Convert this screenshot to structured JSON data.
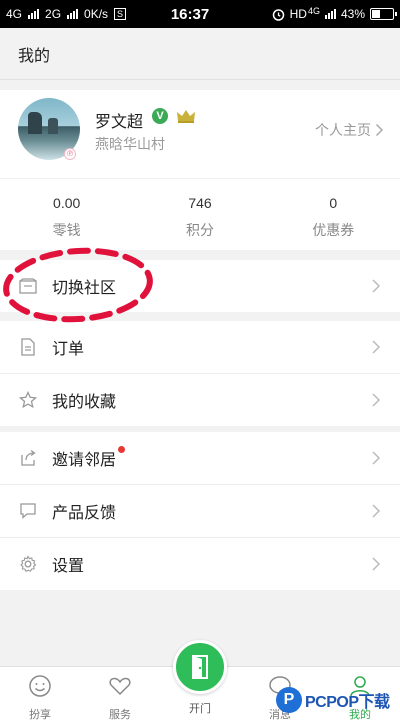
{
  "status_bar": {
    "sim1": "4G",
    "sim2": "2G",
    "speed": "0K/s",
    "sim_icon": "S",
    "time": "16:37",
    "network": "HD",
    "network_type": "4G",
    "battery": "43%",
    "battery_level": 0.43
  },
  "header": {
    "title": "我的"
  },
  "profile": {
    "name": "罗文超",
    "verified_mark": "V",
    "community": "燕晗华山村",
    "homepage_label": "个人主页"
  },
  "stats": [
    {
      "value": "0.00",
      "label": "零钱"
    },
    {
      "value": "746",
      "label": "积分"
    },
    {
      "value": "0",
      "label": "优惠券"
    }
  ],
  "menu": {
    "switch_community": "切换社区",
    "orders": "订单",
    "favorites": "我的收藏",
    "invite": "邀请邻居",
    "feedback": "产品反馈",
    "settings": "设置"
  },
  "tabbar": {
    "share": "扮享",
    "service": "服务",
    "open_door": "开门",
    "message": "消息",
    "mine": "我的"
  },
  "watermark": {
    "logo_letter": "P",
    "text": "PCPOP下载"
  },
  "colors": {
    "accent": "#2ebd58",
    "annotation": "#e0123c",
    "badge": "#e53935"
  }
}
